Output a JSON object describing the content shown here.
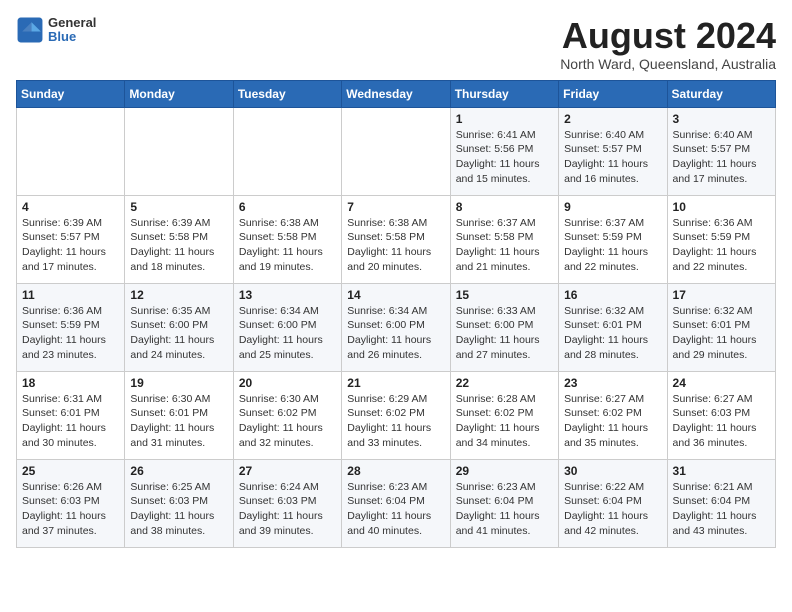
{
  "header": {
    "logo_general": "General",
    "logo_blue": "Blue",
    "month_year": "August 2024",
    "location": "North Ward, Queensland, Australia"
  },
  "days_of_week": [
    "Sunday",
    "Monday",
    "Tuesday",
    "Wednesday",
    "Thursday",
    "Friday",
    "Saturday"
  ],
  "weeks": [
    [
      {
        "day": "",
        "info": ""
      },
      {
        "day": "",
        "info": ""
      },
      {
        "day": "",
        "info": ""
      },
      {
        "day": "",
        "info": ""
      },
      {
        "day": "1",
        "info": "Sunrise: 6:41 AM\nSunset: 5:56 PM\nDaylight: 11 hours and 15 minutes."
      },
      {
        "day": "2",
        "info": "Sunrise: 6:40 AM\nSunset: 5:57 PM\nDaylight: 11 hours and 16 minutes."
      },
      {
        "day": "3",
        "info": "Sunrise: 6:40 AM\nSunset: 5:57 PM\nDaylight: 11 hours and 17 minutes."
      }
    ],
    [
      {
        "day": "4",
        "info": "Sunrise: 6:39 AM\nSunset: 5:57 PM\nDaylight: 11 hours and 17 minutes."
      },
      {
        "day": "5",
        "info": "Sunrise: 6:39 AM\nSunset: 5:58 PM\nDaylight: 11 hours and 18 minutes."
      },
      {
        "day": "6",
        "info": "Sunrise: 6:38 AM\nSunset: 5:58 PM\nDaylight: 11 hours and 19 minutes."
      },
      {
        "day": "7",
        "info": "Sunrise: 6:38 AM\nSunset: 5:58 PM\nDaylight: 11 hours and 20 minutes."
      },
      {
        "day": "8",
        "info": "Sunrise: 6:37 AM\nSunset: 5:58 PM\nDaylight: 11 hours and 21 minutes."
      },
      {
        "day": "9",
        "info": "Sunrise: 6:37 AM\nSunset: 5:59 PM\nDaylight: 11 hours and 22 minutes."
      },
      {
        "day": "10",
        "info": "Sunrise: 6:36 AM\nSunset: 5:59 PM\nDaylight: 11 hours and 22 minutes."
      }
    ],
    [
      {
        "day": "11",
        "info": "Sunrise: 6:36 AM\nSunset: 5:59 PM\nDaylight: 11 hours and 23 minutes."
      },
      {
        "day": "12",
        "info": "Sunrise: 6:35 AM\nSunset: 6:00 PM\nDaylight: 11 hours and 24 minutes."
      },
      {
        "day": "13",
        "info": "Sunrise: 6:34 AM\nSunset: 6:00 PM\nDaylight: 11 hours and 25 minutes."
      },
      {
        "day": "14",
        "info": "Sunrise: 6:34 AM\nSunset: 6:00 PM\nDaylight: 11 hours and 26 minutes."
      },
      {
        "day": "15",
        "info": "Sunrise: 6:33 AM\nSunset: 6:00 PM\nDaylight: 11 hours and 27 minutes."
      },
      {
        "day": "16",
        "info": "Sunrise: 6:32 AM\nSunset: 6:01 PM\nDaylight: 11 hours and 28 minutes."
      },
      {
        "day": "17",
        "info": "Sunrise: 6:32 AM\nSunset: 6:01 PM\nDaylight: 11 hours and 29 minutes."
      }
    ],
    [
      {
        "day": "18",
        "info": "Sunrise: 6:31 AM\nSunset: 6:01 PM\nDaylight: 11 hours and 30 minutes."
      },
      {
        "day": "19",
        "info": "Sunrise: 6:30 AM\nSunset: 6:01 PM\nDaylight: 11 hours and 31 minutes."
      },
      {
        "day": "20",
        "info": "Sunrise: 6:30 AM\nSunset: 6:02 PM\nDaylight: 11 hours and 32 minutes."
      },
      {
        "day": "21",
        "info": "Sunrise: 6:29 AM\nSunset: 6:02 PM\nDaylight: 11 hours and 33 minutes."
      },
      {
        "day": "22",
        "info": "Sunrise: 6:28 AM\nSunset: 6:02 PM\nDaylight: 11 hours and 34 minutes."
      },
      {
        "day": "23",
        "info": "Sunrise: 6:27 AM\nSunset: 6:02 PM\nDaylight: 11 hours and 35 minutes."
      },
      {
        "day": "24",
        "info": "Sunrise: 6:27 AM\nSunset: 6:03 PM\nDaylight: 11 hours and 36 minutes."
      }
    ],
    [
      {
        "day": "25",
        "info": "Sunrise: 6:26 AM\nSunset: 6:03 PM\nDaylight: 11 hours and 37 minutes."
      },
      {
        "day": "26",
        "info": "Sunrise: 6:25 AM\nSunset: 6:03 PM\nDaylight: 11 hours and 38 minutes."
      },
      {
        "day": "27",
        "info": "Sunrise: 6:24 AM\nSunset: 6:03 PM\nDaylight: 11 hours and 39 minutes."
      },
      {
        "day": "28",
        "info": "Sunrise: 6:23 AM\nSunset: 6:04 PM\nDaylight: 11 hours and 40 minutes."
      },
      {
        "day": "29",
        "info": "Sunrise: 6:23 AM\nSunset: 6:04 PM\nDaylight: 11 hours and 41 minutes."
      },
      {
        "day": "30",
        "info": "Sunrise: 6:22 AM\nSunset: 6:04 PM\nDaylight: 11 hours and 42 minutes."
      },
      {
        "day": "31",
        "info": "Sunrise: 6:21 AM\nSunset: 6:04 PM\nDaylight: 11 hours and 43 minutes."
      }
    ]
  ]
}
